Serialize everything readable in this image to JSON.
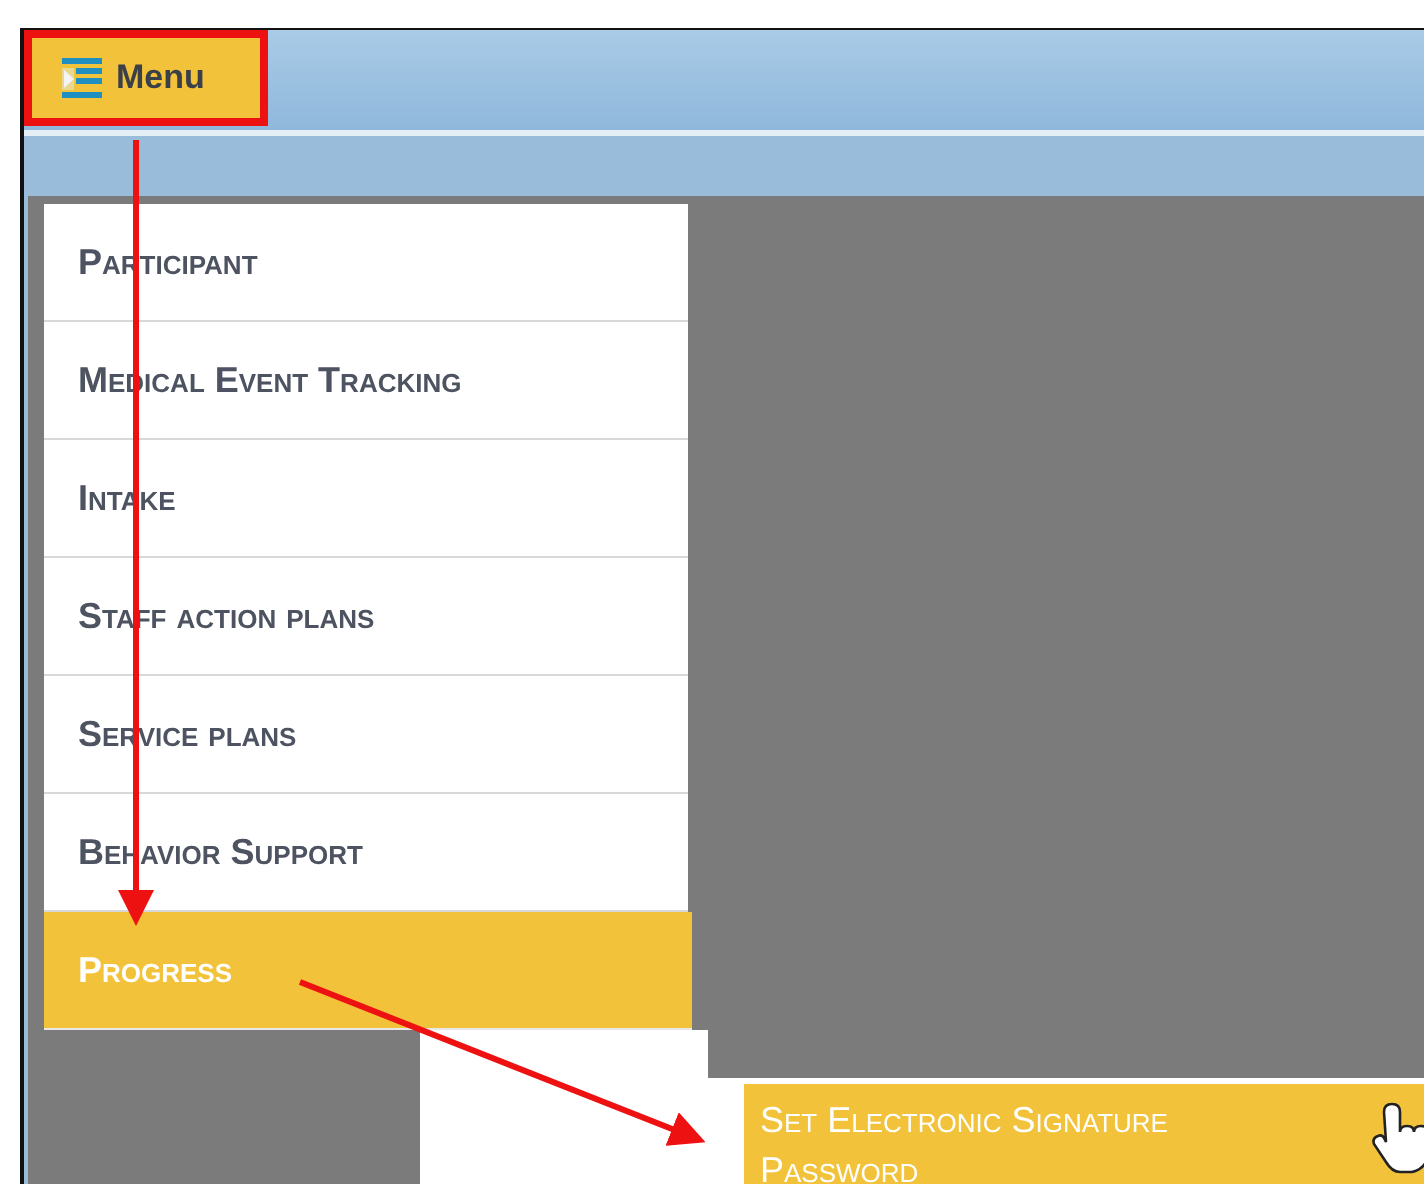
{
  "toolbar": {
    "menu_button": "Menu"
  },
  "menu": {
    "items": [
      {
        "label": "Participant",
        "selected": false
      },
      {
        "label": "Medical Event Tracking",
        "selected": false
      },
      {
        "label": "Intake",
        "selected": false
      },
      {
        "label": "Staff action plans",
        "selected": false
      },
      {
        "label": "Service plans",
        "selected": false
      },
      {
        "label": "Behavior Support",
        "selected": false
      },
      {
        "label": "Progress",
        "selected": true
      }
    ]
  },
  "submenu": {
    "items": [
      {
        "label": "Set Electronic Signature Password",
        "selected": true
      }
    ]
  }
}
